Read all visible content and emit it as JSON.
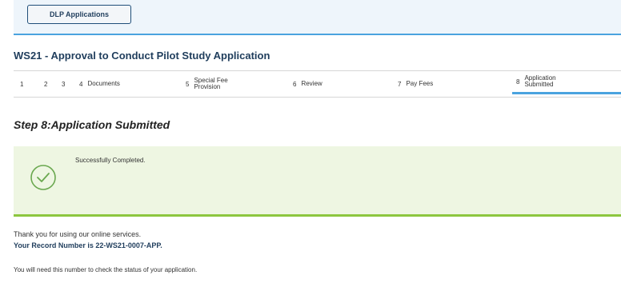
{
  "header": {
    "dlp_button_label": "DLP Applications"
  },
  "application": {
    "title": "WS21 - Approval to Conduct Pilot Study Application"
  },
  "steps": [
    {
      "num": "1",
      "label": ""
    },
    {
      "num": "2",
      "label": ""
    },
    {
      "num": "3",
      "label": ""
    },
    {
      "num": "4",
      "label": "Documents"
    },
    {
      "num": "5",
      "label": "Special Fee Provision"
    },
    {
      "num": "6",
      "label": "Review"
    },
    {
      "num": "7",
      "label": "Pay Fees"
    },
    {
      "num": "8",
      "label": "Application Submitted"
    }
  ],
  "main": {
    "step_heading": "Step 8:Application Submitted",
    "success_message": "Successfully Completed.",
    "thanks_text": "Thank you for using our online services.",
    "record_text": "Your Record Number is 22-WS21-0007-APP.",
    "note_text": "You will need this number to check the status of your application."
  },
  "colors": {
    "accent": "#4aa3df",
    "success": "#8cc63f",
    "success_bg": "#eef6e2"
  }
}
